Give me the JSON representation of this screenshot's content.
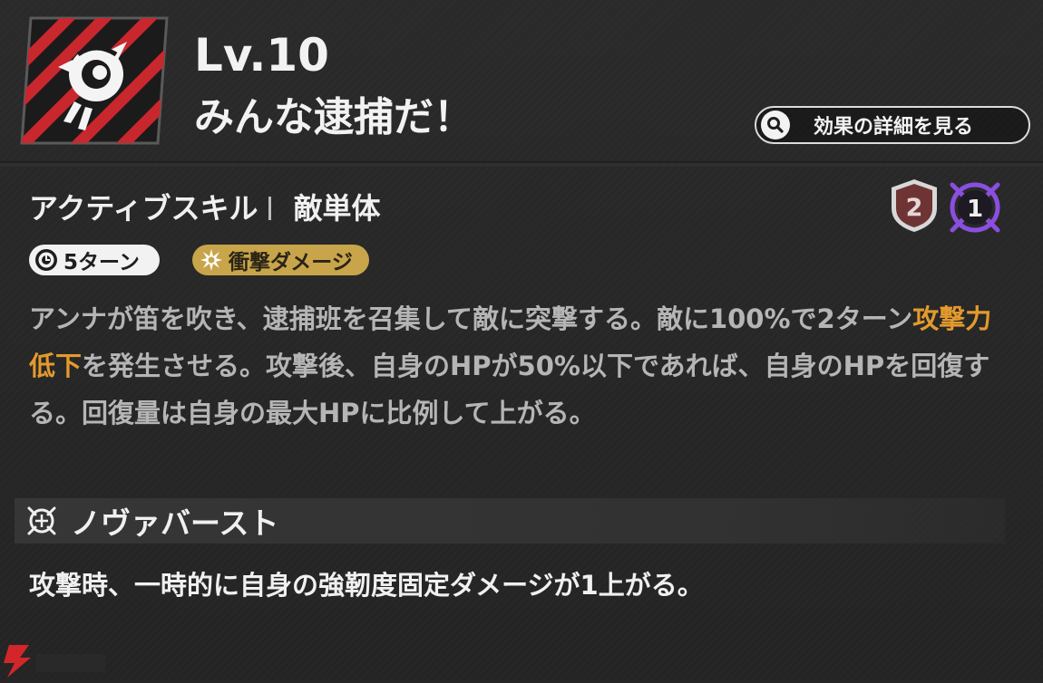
{
  "header": {
    "level": "Lv.10",
    "skill_name": "みんな逮捕だ！",
    "detail_button_label": "効果の詳細を見る"
  },
  "skill": {
    "type": "アクティブスキル",
    "target": "敵単体",
    "cost_badge": "2",
    "burst_badge": "1",
    "tags": {
      "turns": "5ターン",
      "damage_type": "衝撃ダメージ"
    },
    "description": {
      "part1": "アンナが笛を吹き、逮捕班を召集して敵に突撃する。敵に100%で2ターン",
      "highlight": "攻撃力低下",
      "part2": "を発生させる。攻撃後、自身のHPが50%以下であれば、自身のHPを回復する。回復量は自身の最大HPに比例して上がる。"
    }
  },
  "nova_burst": {
    "title": "ノヴァバースト",
    "description": "攻撃時、一時的に自身の強靭度固定ダメージが1上がる。"
  },
  "colors": {
    "background": "#262626",
    "highlight": "#e39a2d",
    "impact_tag": "#c8a54a",
    "icon_red": "#c8272d",
    "burst_purple": "#8a4fe0"
  },
  "icons": {
    "skill": "police-whistle-skill-icon",
    "detail": "magnifier-icon",
    "turn": "clock-icon",
    "impact": "impact-burst-icon",
    "cost": "shield-cost-icon",
    "burst": "crosshair-burst-icon",
    "nova": "nova-crosshair-icon"
  }
}
